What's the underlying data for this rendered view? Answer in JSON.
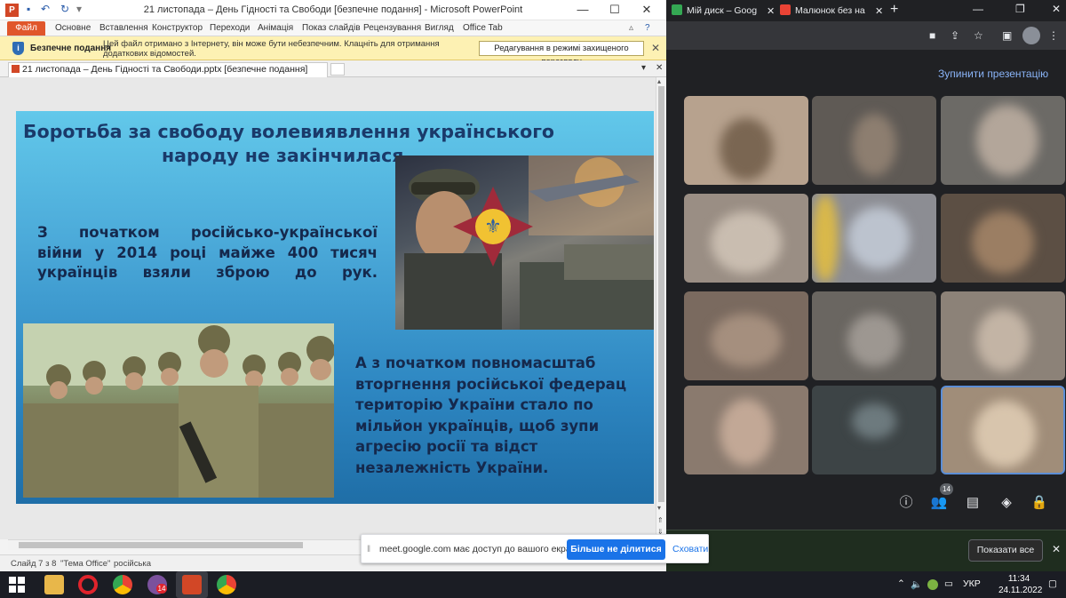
{
  "ppt": {
    "window_title": "21 листопада – День Гідності та Свободи [безпечне подання] - Microsoft PowerPoint",
    "ribbon_tabs": [
      "Файл",
      "Основне",
      "Вставлення",
      "Конструктор",
      "Переходи",
      "Анімація",
      "Показ слайдів",
      "Рецензування",
      "Вигляд",
      "Office Tab"
    ],
    "message_bar": {
      "label": "Безпечне подання",
      "text": "Цей файл отримано з Інтернету, він може бути небезпечним. Клацніть для отримання додаткових відомостей.",
      "button": "Редагування в режимі захищеного перегляду"
    },
    "doc_tab": "21 листопада – День Гідності та Свободи.pptx [безпечне подання]",
    "status": {
      "slide": "Слайд 7 з 8",
      "theme": "\"Тема Office\"",
      "language": "російська"
    }
  },
  "slide": {
    "title_line1": "Боротьба за свободу волевиявлення українського",
    "title_line2": "народу не закінчилася.",
    "para1_lines": [
      "З початком російсько-української",
      "війни у 2014 році майже 400 тисяч",
      "українців взяли зброю до рук."
    ],
    "para2_lines": [
      "А з початком повномасштаб",
      "вторгнення російської федерац",
      "територію України стало по",
      "мільйон українців, щоб зупи",
      "агресію росії та відст",
      "незалежність України."
    ]
  },
  "chrome": {
    "tab1": "Мій диск – Goog",
    "tab2": "Малюнок без на"
  },
  "meet": {
    "stop_presenting": "Зупинити презентацію",
    "participants_count": "14",
    "show_all": "Показати все"
  },
  "share": {
    "message": "meet.google.com має доступ до вашого екрана.",
    "stop_button": "Більше не ділитися",
    "hide_button": "Сховати"
  },
  "taskbar": {
    "language": "УКР",
    "time": "11:34",
    "date": "24.11.2022",
    "viber_badge": "14"
  }
}
